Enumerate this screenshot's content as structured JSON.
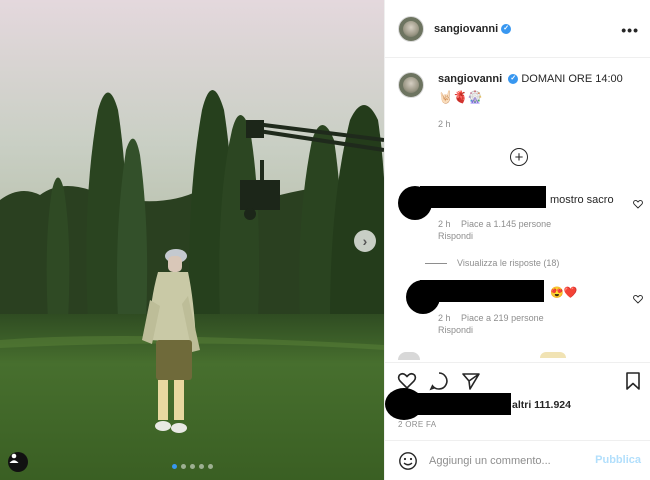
{
  "post": {
    "username": "sangiovanni",
    "verified": true,
    "carousel": {
      "total": 5,
      "active": 0
    }
  },
  "caption": {
    "text": "DOMANI ORE 14:00",
    "emoji": "🤘🏻🫀🎡",
    "time": "2 h"
  },
  "comments": [
    {
      "text": "mostro sacro",
      "time": "2 h",
      "likes": "Piace a 1.145 persone",
      "reply": "Rispondi",
      "view_replies": "Visualizza le risposte (18)"
    },
    {
      "text": "😍❤️",
      "time": "2 h",
      "likes": "Piace a 219 persone",
      "reply": "Rispondi"
    }
  ],
  "likes_summary": "altri 111.924",
  "post_time": "2 ORE FA",
  "add_comment": {
    "placeholder": "Aggiungi un commento...",
    "publish_label": "Pubblica"
  },
  "icons": {
    "more": "more-horizontal-icon",
    "add": "plus-circle-icon",
    "like": "heart-icon",
    "comment": "comment-icon",
    "share": "send-icon",
    "save": "bookmark-icon",
    "emoji": "smile-icon",
    "next": "chevron-right-icon",
    "tag": "user-tag-icon"
  },
  "colors": {
    "accent": "#3897f0",
    "muted": "#8e8e8e",
    "publish_disabled": "#b2dffc"
  }
}
